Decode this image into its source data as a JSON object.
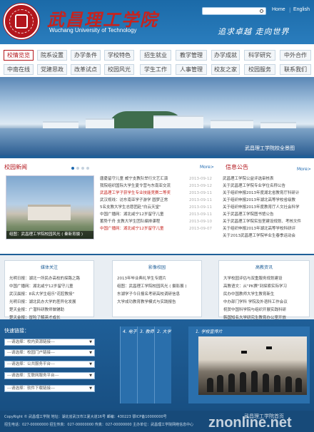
{
  "header": {
    "school_name_cn": "武昌理工学院",
    "school_name_en": "Wuchang University of Technology",
    "slogan": "追求卓越  走向世界",
    "lang_home": "Home",
    "lang_english": "English",
    "search": {
      "placeholder": ""
    }
  },
  "nav": {
    "row1": [
      "校情览览",
      "院系设置",
      "办学条件",
      "学校特色",
      "招生就业",
      "教学管理",
      "办学成就",
      "科学研究",
      "中外合作"
    ],
    "row2": [
      "中南在线",
      "党建思政",
      "改革试点",
      "校园风光",
      "学生工作",
      "人事管理",
      "校友之家",
      "校园服务",
      "联系我们"
    ]
  },
  "banner": {
    "caption": "武昌理工学院校全景图"
  },
  "campus_news": {
    "title": "校园新闻",
    "more": "More>",
    "photo_caption": "组图：武昌理工学院校园风光 ( 秦新育摄 )",
    "items": [
      {
        "title": "唐憂留守儿童  威宁支教队举行文艺汇演",
        "date": "2013-09-12",
        "highlight": false
      },
      {
        "title": "我院组织国际大学生夏令营与东南亚交流",
        "date": "2013-09-12",
        "highlight": false
      },
      {
        "title": "武昌理工学子获学生专业技能竞赛二等奖",
        "date": "2013-09-11",
        "highlight": true
      },
      {
        "title": "武汉视线：访东南亚学子游学 圆梦正常",
        "date": "2013-09-11",
        "highlight": false
      },
      {
        "title": "5名支教大学生志愿团赴\"白云天堂\"",
        "date": "2013-09-11",
        "highlight": false
      },
      {
        "title": "中国广播网：湖北咸宁12岁留守儿童",
        "date": "2013-09-11",
        "highlight": false
      },
      {
        "title": "蓄势千舟 支教大学生团队编排课程",
        "date": "2013-09-10",
        "highlight": false
      },
      {
        "title": "中国广播网：湖北咸宁12岁留守儿童",
        "date": "2013-09-07",
        "highlight": true
      }
    ]
  },
  "notice": {
    "title": "信息公告",
    "more": "More>",
    "items": [
      "武昌理工学院公益评选审核表",
      "关于武昌理工学院专业学位名称公告",
      "关于组织申报2013年度湖北省教育厅科研计",
      "关于组织申报2013年湖北高等学校省级教",
      "关于组织申报2013年度教育厅人文社会科学",
      "关于武昌理工学院图书馆公告",
      "关于武昌理工学院实验室建设规划、考核文件",
      "关于组织申报2013年湖北高等学校科研评",
      "关于2013武昌理工学院毕业生春季运动会"
    ]
  },
  "media": {
    "title": "媒体关注",
    "items": [
      "光明日报：湖北一所民办高校的探路之路",
      "中国广播网：湖北咸宁12岁留守儿童",
      "武汉晨报：8名大学生组乐\"花腔教授\"",
      "光明日报：湖北民办大学的差异化发展",
      "楚天金报：广潜科研教师做辅助",
      "楚天金报：冒险了解英才成长"
    ]
  },
  "video": {
    "title": "影像校园",
    "items": [
      "2013年毕业典礼学生专题片",
      "组图：武昌理工学院校园风光 ( 摄影展 )",
      "东湖学子今日报名考研高校调研信息",
      "大学成功教育教学模式与实践报告"
    ]
  },
  "hr": {
    "title": "高教资讯",
    "items": [
      "大学校园评估与双重服务规划建设",
      "高教语文：从\"PK赛\"到探索实际学习",
      "民办中国教师大学生教育新生",
      "中办部门学科 学院及外语科工作会议",
      "祝贺中国科学院与组织开展实践科研",
      "韩国知名大学研究生教育办公室开放"
    ]
  },
  "quick_links": {
    "title": "快速链接：",
    "options": [
      "---请选择：校内资源链接---",
      "---请选择：校园门户链接---",
      "---请选择：公共服务平台---",
      "---请选择：互联网服务平台---",
      "---请选择：软件下载链接---"
    ]
  },
  "showcase": {
    "tabs": [
      "4. 电子",
      "3. 教师",
      "2. 大学",
      "1. 学校宣传片"
    ],
    "active": "1. 学校宣传片"
  },
  "footer": {
    "line1": "CopyRight © 武昌理工学院  地址：湖北省武汉市江夏大道16号  邮编：430223  鄂ICP备10000000号",
    "line2": "招生电话：027-00000000  招生传真：027-00000000  传真：027-00000000  主办单位：武昌理工学院网络信息中心",
    "watermark": "znonline.net",
    "watermark_sub": "武昌理工学院首页"
  },
  "colors": {
    "brand_blue": "#1f5f98",
    "brand_red": "#b3161c"
  }
}
